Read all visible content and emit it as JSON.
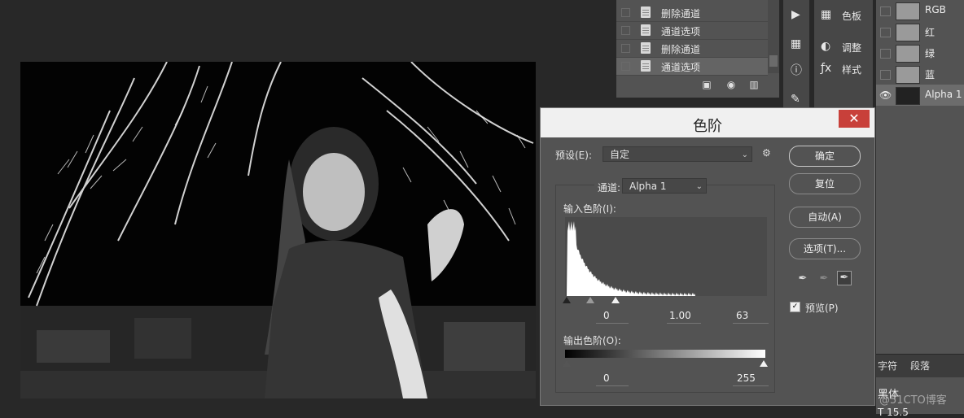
{
  "history": {
    "items": [
      {
        "label": "删除通道",
        "selected": false
      },
      {
        "label": "通道选项",
        "selected": false
      },
      {
        "label": "删除通道",
        "selected": false
      },
      {
        "label": "通道选项",
        "selected": true
      }
    ],
    "icons": [
      "camera-icon",
      "new-snapshot-icon",
      "trash-icon"
    ]
  },
  "side_panels": {
    "swatches": "色板",
    "adjustments": "调整",
    "styles": "样式"
  },
  "channels": {
    "items": [
      {
        "name": "RGB",
        "visible": false,
        "selected": false
      },
      {
        "name": "红",
        "visible": false,
        "selected": false
      },
      {
        "name": "绿",
        "visible": false,
        "selected": false
      },
      {
        "name": "蓝",
        "visible": false,
        "selected": false
      },
      {
        "name": "Alpha 1",
        "visible": true,
        "selected": true
      }
    ]
  },
  "character_panel": {
    "tabs": [
      "字符",
      "段落"
    ],
    "font": "黑体",
    "size_fragment": "T 15.5"
  },
  "levels_dialog": {
    "title": "色阶",
    "close": "✕",
    "preset_label": "预设(E):",
    "preset_value": "自定",
    "channel_label": "通道:",
    "channel_value": "Alpha 1",
    "input_label": "输入色阶(I):",
    "input_black": "0",
    "input_gamma": "1.00",
    "input_white": "63",
    "output_label": "输出色阶(O):",
    "output_black": "0",
    "output_white": "255",
    "buttons": {
      "ok": "确定",
      "reset": "复位",
      "auto": "自动(A)",
      "options": "选项(T)..."
    },
    "preview_label": "预览(P)",
    "preview_checked": true
  },
  "watermark": "@51CTO博客",
  "colors": {
    "panel": "#535353",
    "background": "#282828",
    "close_button": "#c8403a"
  }
}
